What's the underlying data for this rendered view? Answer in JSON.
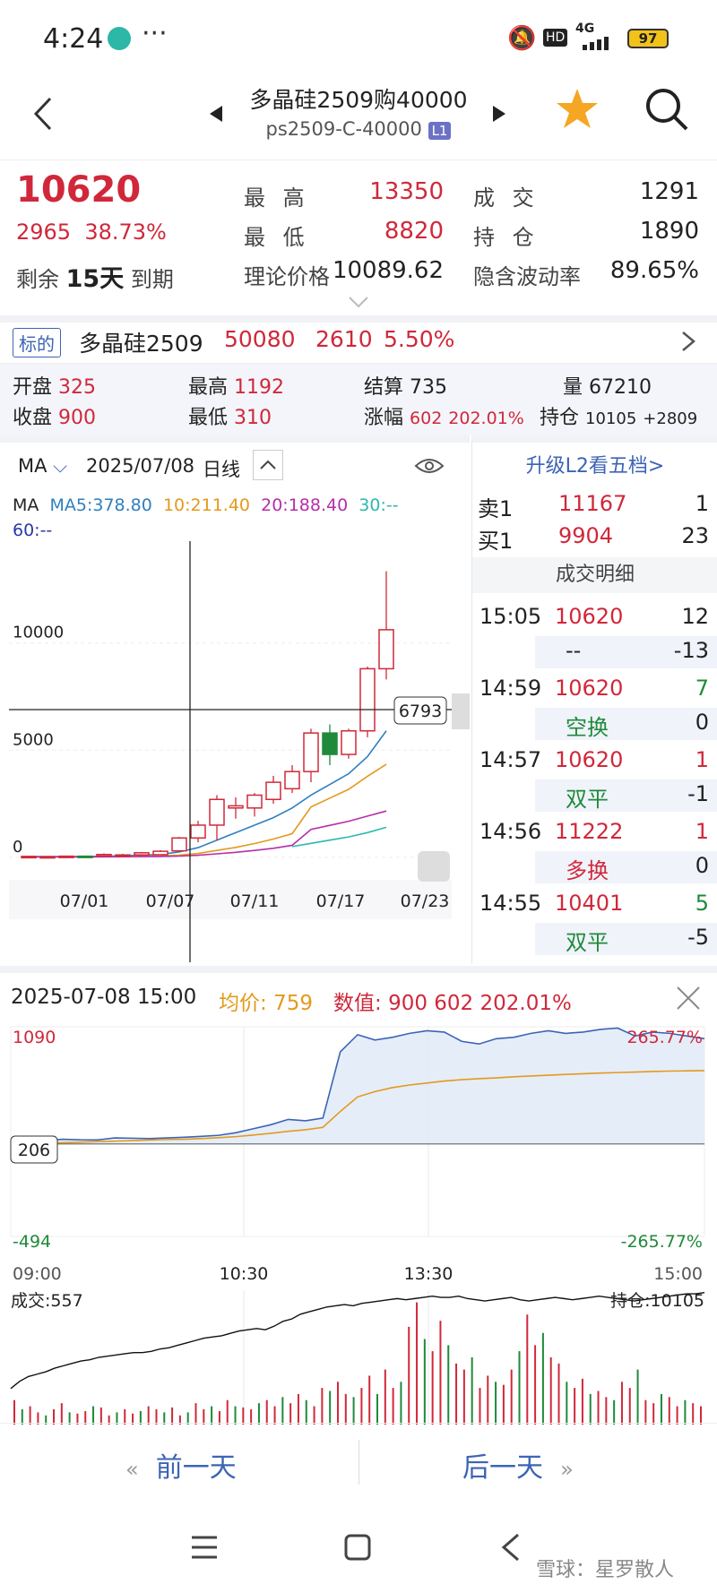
{
  "status": {
    "time": "4:24",
    "dots": "···",
    "network": "4G",
    "hd": "HD",
    "battery": "97"
  },
  "nav": {
    "title": "多晶硅2509购40000",
    "code": "ps2509-C-40000",
    "level": "L1"
  },
  "quote": {
    "price": "10620",
    "change": "2965",
    "change_pct": "38.73%",
    "remain_label": "剩余",
    "remain_days": "15天",
    "remain_suffix": "到期",
    "high_label": "最 高",
    "high": "13350",
    "low_label": "最 低",
    "low": "8820",
    "vol_label": "成 交",
    "vol": "1291",
    "oi_label": "持 仓",
    "oi": "1890",
    "theo_label": "理论价格",
    "theo": "10089.62",
    "iv_label": "隐含波动率",
    "iv": "89.65%"
  },
  "underlying": {
    "tag": "标的",
    "name": "多晶硅2509",
    "price": "50080",
    "change": "2610",
    "pct": "5.50%"
  },
  "day_stats": {
    "open_label": "开盘",
    "open": "325",
    "high_label": "最高",
    "high": "1192",
    "settle_label": "结算",
    "settle": "735",
    "vol_label": "量",
    "vol": "67210",
    "close_label": "收盘",
    "close": "900",
    "low_label": "最低",
    "low": "310",
    "chg_label": "涨幅",
    "chg": "602",
    "chg_pct": "202.01%",
    "oi_label": "持仓",
    "oi": "10105",
    "oi_chg": "+2809"
  },
  "kline": {
    "indicator": "MA",
    "date": "2025/07/08",
    "period": "日线",
    "ma_title": "MA",
    "ma5": "MA5:378.80",
    "ma10": "10:211.40",
    "ma20": "20:188.40",
    "ma30": "30:--",
    "ma60": "60:--",
    "crosshair_value": "6793"
  },
  "trades": {
    "upgrade": "升级L2看五档>",
    "ask_label": "卖1",
    "ask_price": "11167",
    "ask_vol": "1",
    "bid_label": "买1",
    "bid_price": "9904",
    "bid_vol": "23",
    "detail_title": "成交明细",
    "rows": [
      {
        "time": "15:05",
        "price": "10620",
        "vol": "12",
        "type": "--",
        "oi": "-13"
      },
      {
        "time": "14:59",
        "price": "10620",
        "vol": "7",
        "type": "空换",
        "oi": "0"
      },
      {
        "time": "14:57",
        "price": "10620",
        "vol": "1",
        "type": "双平",
        "oi": "-1"
      },
      {
        "time": "14:56",
        "price": "11222",
        "vol": "1",
        "type": "多换",
        "oi": "0"
      },
      {
        "time": "14:55",
        "price": "10401",
        "vol": "5",
        "type": "双平",
        "oi": "-5"
      }
    ]
  },
  "intraday": {
    "datetime": "2025-07-08  15:00",
    "avg_label": "均价:",
    "avg": "759",
    "val_label": "数值:",
    "val": "900 602 202.01%",
    "top_left": "1090",
    "top_right": "265.77%",
    "base": "206",
    "bot_left": "-494",
    "bot_right": "-265.77%",
    "times": [
      "09:00",
      "10:30",
      "13:30",
      "15:00"
    ],
    "vol_label": "成交:557",
    "oi_label": "持仓:10105"
  },
  "dayswitch": {
    "prev": "前一天",
    "next": "后一天"
  },
  "watermark": "雪球：星罗散人",
  "colors": {
    "up": "#d0283a",
    "down": "#1f8a3a",
    "avg": "#e39a1c",
    "accent": "#3c64b4"
  },
  "chart_data": [
    {
      "type": "candlestick",
      "title": "",
      "x_ticks": [
        "07/01",
        "07/07",
        "07/11",
        "07/17",
        "07/23"
      ],
      "y_ticks": [
        0,
        5000,
        10000
      ],
      "ylim": [
        -300,
        13500
      ],
      "candles": [
        {
          "o": 25,
          "h": 60,
          "l": 10,
          "c": 40
        },
        {
          "o": 30,
          "h": 50,
          "l": 10,
          "c": 30
        },
        {
          "o": 35,
          "h": 70,
          "l": 15,
          "c": 50
        },
        {
          "o": 50,
          "h": 70,
          "l": 20,
          "c": 40
        },
        {
          "o": 60,
          "h": 180,
          "l": 30,
          "c": 130
        },
        {
          "o": 80,
          "h": 160,
          "l": 50,
          "c": 110
        },
        {
          "o": 110,
          "h": 250,
          "l": 80,
          "c": 210
        },
        {
          "o": 120,
          "h": 330,
          "l": 100,
          "c": 280
        },
        {
          "o": 300,
          "h": 950,
          "l": 250,
          "c": 900
        },
        {
          "o": 900,
          "h": 1700,
          "l": 700,
          "c": 1500
        },
        {
          "o": 1500,
          "h": 2900,
          "l": 800,
          "c": 2700
        },
        {
          "o": 2300,
          "h": 2800,
          "l": 1800,
          "c": 2400
        },
        {
          "o": 2300,
          "h": 3000,
          "l": 1900,
          "c": 2900
        },
        {
          "o": 2700,
          "h": 3800,
          "l": 2500,
          "c": 3500
        },
        {
          "o": 3200,
          "h": 4300,
          "l": 3000,
          "c": 4000
        },
        {
          "o": 4000,
          "h": 6000,
          "l": 3500,
          "c": 5800
        },
        {
          "o": 5800,
          "h": 6200,
          "l": 4300,
          "c": 4800
        },
        {
          "o": 4800,
          "h": 6000,
          "l": 4600,
          "c": 5900
        },
        {
          "o": 5900,
          "h": 8900,
          "l": 5600,
          "c": 8800
        },
        {
          "o": 8800,
          "h": 13350,
          "l": 8300,
          "c": 10620
        }
      ]
    },
    {
      "type": "line",
      "title": "",
      "x_ticks": [
        "09:00",
        "10:30",
        "13:30",
        "15:00"
      ],
      "ylim": [
        -494,
        1090
      ],
      "base": 206,
      "series": [
        {
          "values": [
            206,
            215,
            230,
            240,
            236,
            235,
            250,
            248,
            245,
            250,
            255,
            262,
            270,
            290,
            320,
            350,
            390,
            380,
            400,
            900,
            1030,
            990,
            1010,
            1040,
            1060,
            1050,
            980,
            960,
            1000,
            1010,
            1040,
            1060,
            1040,
            1050,
            1070,
            1080,
            1020,
            1050,
            1040,
            1020,
            1000
          ]
        },
        {
          "values": [
            206,
            207,
            210,
            214,
            218,
            222,
            226,
            230,
            234,
            238,
            240,
            245,
            252,
            260,
            272,
            285,
            300,
            312,
            330,
            450,
            560,
            600,
            630,
            650,
            665,
            680,
            690,
            698,
            704,
            712,
            718,
            724,
            730,
            735,
            740,
            744,
            748,
            752,
            755,
            757,
            759
          ]
        }
      ]
    },
    {
      "type": "bar",
      "title": "",
      "label": "成交:557",
      "values": [
        40,
        25,
        30,
        20,
        15,
        25,
        35,
        20,
        18,
        22,
        30,
        28,
        15,
        20,
        25,
        18,
        22,
        30,
        25,
        20,
        28,
        15,
        20,
        35,
        25,
        30,
        22,
        40,
        30,
        28,
        25,
        35,
        40,
        30,
        45,
        35,
        50,
        40,
        30,
        60,
        55,
        70,
        50,
        45,
        60,
        80,
        50,
        90,
        60,
        70,
        160,
        200,
        140,
        120,
        170,
        130,
        100,
        90,
        110,
        60,
        80,
        70,
        65,
        90,
        120,
        180,
        130,
        150,
        110,
        100,
        70,
        60,
        75,
        50,
        55,
        45,
        40,
        70,
        60,
        90,
        40,
        35,
        50,
        45,
        30,
        40,
        35,
        30
      ],
      "oi_line": [
        150,
        180,
        200,
        210,
        220,
        235,
        245,
        255,
        265,
        270,
        280,
        285,
        290,
        295,
        300,
        300,
        305,
        315,
        320,
        330,
        340,
        350,
        360,
        365,
        370,
        380,
        390,
        395,
        400,
        395,
        410,
        430,
        440,
        460,
        470,
        480,
        490,
        495,
        500,
        495,
        505,
        510,
        515,
        520,
        525,
        520,
        525,
        530,
        535,
        530,
        530,
        535,
        525,
        520,
        515,
        520,
        525,
        530,
        520,
        515,
        520,
        525,
        530,
        525,
        520,
        525,
        530,
        535,
        530,
        525,
        520,
        515,
        520,
        525,
        530,
        535,
        540,
        545,
        545,
        550
      ]
    }
  ]
}
